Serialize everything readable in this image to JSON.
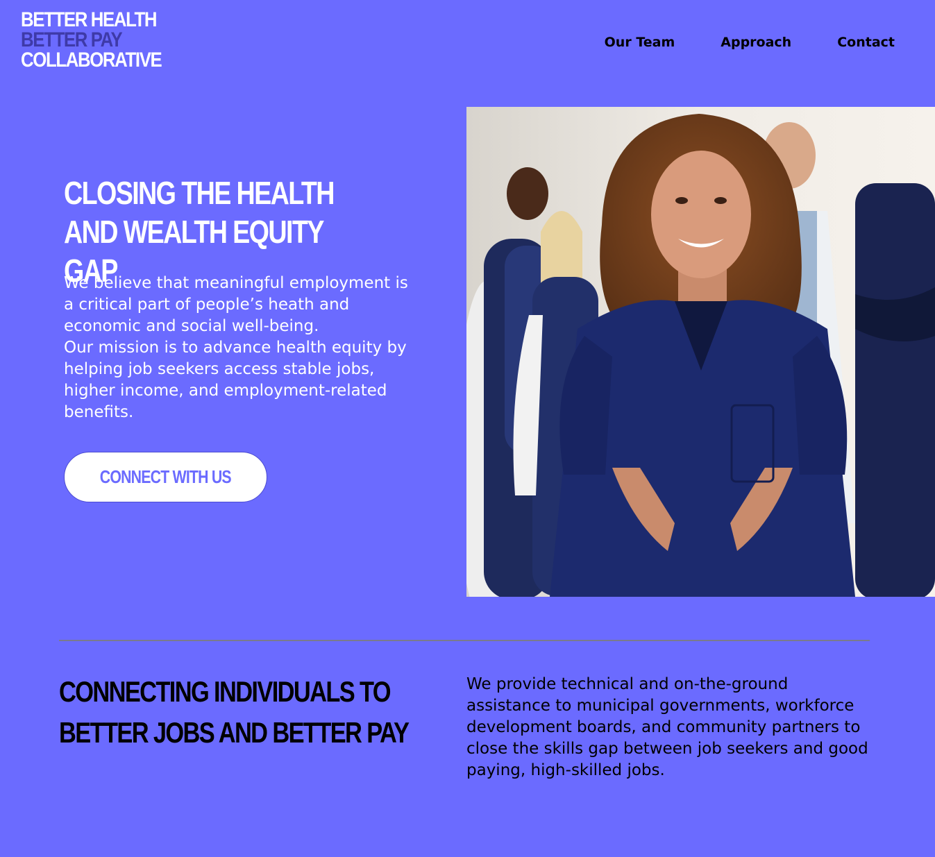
{
  "colors": {
    "background": "#6b6bff",
    "logo_accent": "#3e3aa8",
    "button_bg": "#ffffff",
    "button_text": "#6b6bff"
  },
  "logo": {
    "line1": "BETTER HEALTH",
    "line2": "BETTER PAY",
    "line3": "COLLABORATIVE"
  },
  "nav": {
    "items": [
      "Our Team",
      "Approach",
      "Contact"
    ]
  },
  "hero": {
    "title": "CLOSING THE HEALTH AND WEALTH EQUITY GAP",
    "paragraph1": "We believe that meaningful employment is a critical part of people’s heath and economic and social well-being.",
    "paragraph2": "Our mission is to advance health equity by helping job seekers access stable jobs, higher income, and employment-related benefits.",
    "cta_label": "CONNECT WITH US",
    "photo_alt": "Smiling healthcare worker in navy scrubs standing in front of a group of medical colleagues"
  },
  "section": {
    "title": "CONNECTING INDIVIDUALS TO BETTER JOBS AND BETTER PAY",
    "text": "We provide technical and on-the-ground assistance to municipal governments, workforce development boards, and community partners to close the skills gap between job seekers and good paying, high-skilled jobs."
  }
}
